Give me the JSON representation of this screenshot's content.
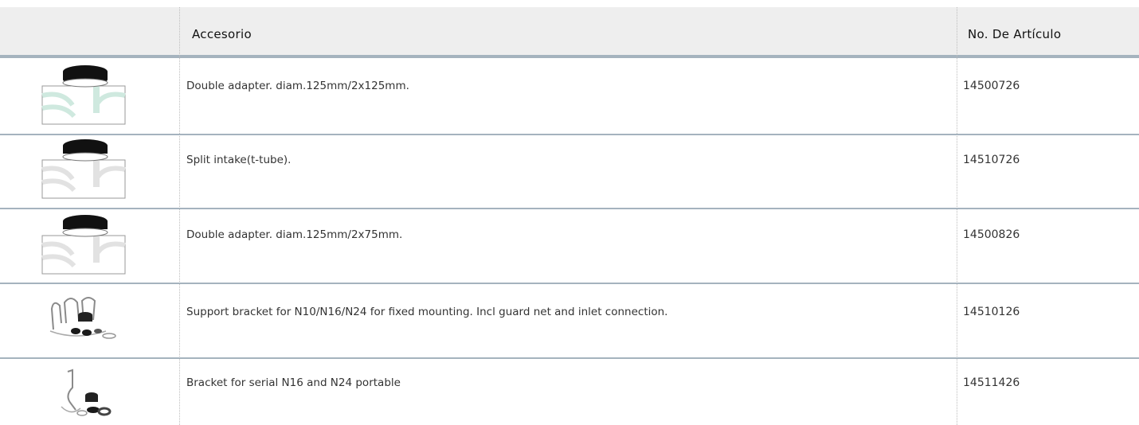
{
  "table": {
    "headers": {
      "image": "",
      "name": "Accesorio",
      "article": "No. De Artículo"
    },
    "rows": [
      {
        "icon": "t-adapter-green-icon",
        "description": "Double adapter. diam.125mm/2x125mm.",
        "article_no": "14500726"
      },
      {
        "icon": "t-adapter-grey-icon",
        "description": "Split intake(t-tube).",
        "article_no": "14510726"
      },
      {
        "icon": "t-adapter-grey-icon",
        "description": "Double adapter. diam.125mm/2x75mm.",
        "article_no": "14500826"
      },
      {
        "icon": "support-bracket-icon",
        "description": "Support bracket for N10/N16/N24 for fixed mounting. Incl guard net and inlet connection.",
        "article_no": "14510126"
      },
      {
        "icon": "portable-bracket-icon",
        "description": "Bracket for serial N16 and N24 portable",
        "article_no": "14511426"
      }
    ]
  },
  "colors": {
    "header_bg": "#eeeeee",
    "row_rule": "#a5b3be",
    "accent_green": "#cfe9df",
    "accent_grey": "#e2e2e2"
  }
}
